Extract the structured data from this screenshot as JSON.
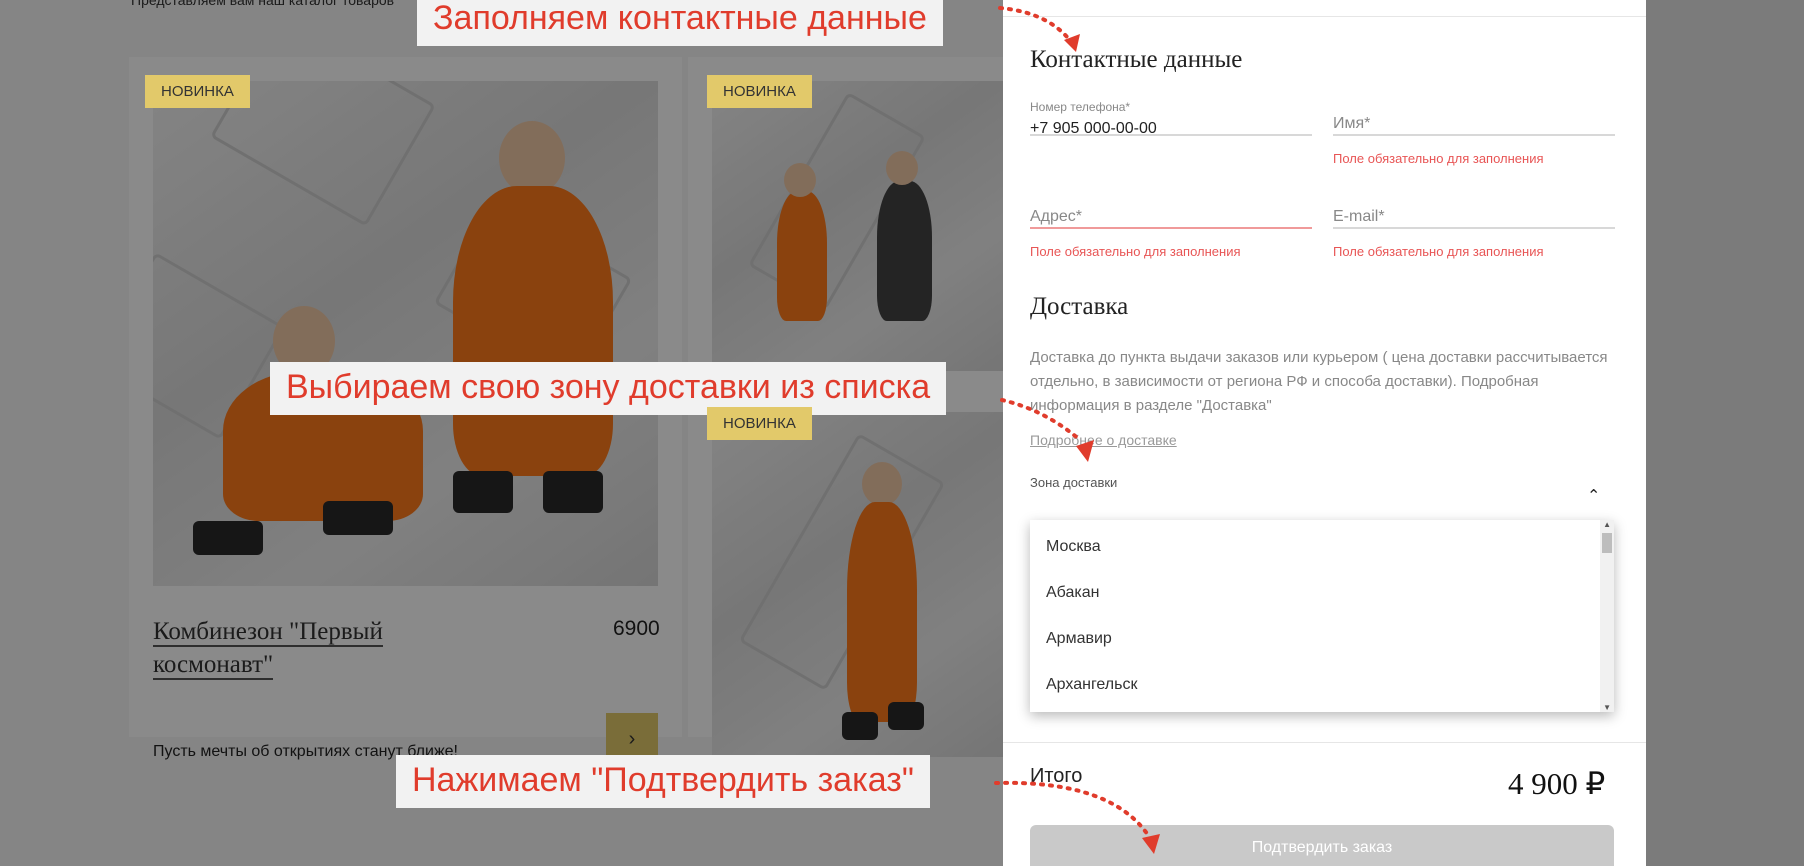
{
  "catalog": {
    "intro_text": "Представляем вам наш каталог товаров",
    "badge_new": "НОВИНКА",
    "product": {
      "name": "Комбинезон \"Первый космонавт\"",
      "price": "6900",
      "description": "Пусть мечты об открытиях станут ближе!"
    }
  },
  "order_form": {
    "contact_title": "Контактные данные",
    "phone_label": "Номер телефона*",
    "phone_value": "+7 905 000-00-00",
    "name_placeholder": "Имя*",
    "address_placeholder": "Адрес*",
    "email_placeholder": "E-mail*",
    "required_error": "Поле обязательно для заполнения",
    "delivery_title": "Доставка",
    "delivery_text": "Доставка до пункта выдачи заказов или курьером ( цена доставки рассчитывается отдельно, в зависимости от региона РФ и способа доставки). Подробная информация в разделе \"Доставка\"",
    "delivery_link": "Подробнее о доставке",
    "zone_label": "Зона доставки",
    "zone_options": [
      "Москва",
      "Абакан",
      "Армавир",
      "Архангельск"
    ],
    "total_label": "Итого",
    "total_value": "4 900 ₽",
    "submit_label": "Подтвердить заказ"
  },
  "annotations": {
    "step1": "Заполняем контактные данные",
    "step2": "Выбираем свою зону доставки из списка",
    "step3": "Нажимаем \"Подтвердить заказ\""
  },
  "colors": {
    "accent_gold": "#e2c96a",
    "error_red": "#e85555",
    "annotation_red": "#e03c2c",
    "overlay": "rgba(0,0,0,0.46)"
  },
  "icons": [
    "chevron-right-icon",
    "chevron-up-icon",
    "scroll-arrow-up-icon",
    "scroll-arrow-down-icon"
  ]
}
